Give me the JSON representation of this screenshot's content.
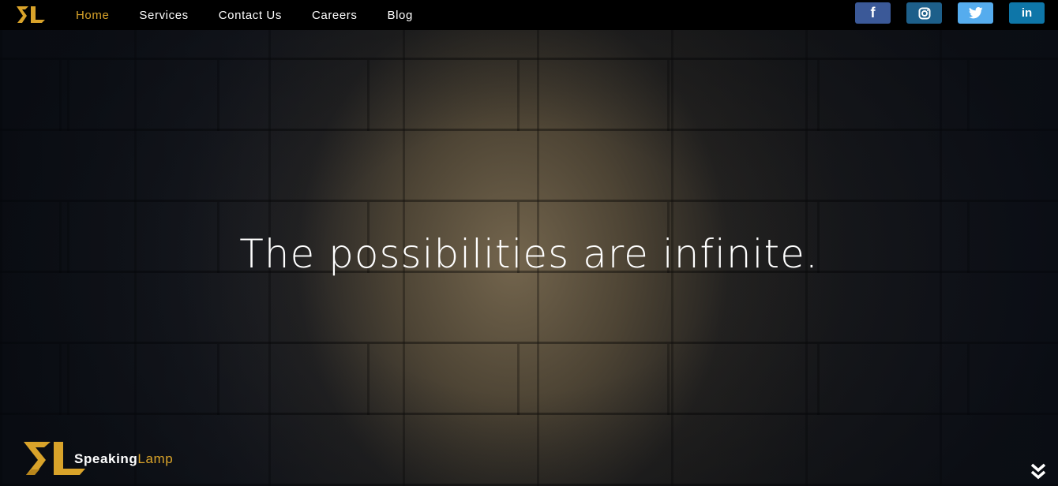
{
  "nav": {
    "links": [
      {
        "label": "Home",
        "active": true
      },
      {
        "label": "Services",
        "active": false
      },
      {
        "label": "Contact Us",
        "active": false
      },
      {
        "label": "Careers",
        "active": false
      },
      {
        "label": "Blog",
        "active": false
      }
    ]
  },
  "social": {
    "facebook": {
      "icon": "facebook-icon",
      "glyph": "f",
      "color": "#3b5998"
    },
    "instagram": {
      "icon": "instagram-icon",
      "color": "#1d5f8a"
    },
    "twitter": {
      "icon": "twitter-icon",
      "color": "#55acee"
    },
    "linkedin": {
      "icon": "linkedin-icon",
      "glyph": "in",
      "color": "#0e76a8"
    }
  },
  "hero": {
    "title": "The possibilities are infinite."
  },
  "brand": {
    "name_part1": "Speaking",
    "name_part2": "Lamp"
  },
  "colors": {
    "accent": "#d9a32a",
    "nav_bg": "#000000"
  }
}
